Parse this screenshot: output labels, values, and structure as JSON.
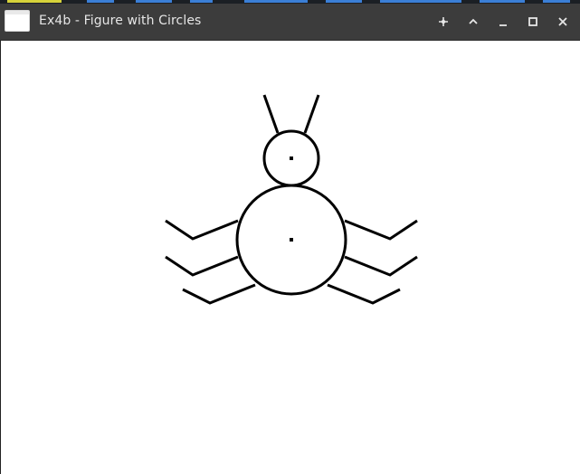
{
  "window": {
    "title": "Ex4b - Figure with Circles"
  },
  "titlebar_buttons": [
    {
      "name": "keep-above",
      "icon": "crosshair-plus-icon"
    },
    {
      "name": "shade",
      "icon": "chevron-up-icon"
    },
    {
      "name": "minimize",
      "icon": "minimize-icon"
    },
    {
      "name": "maximize",
      "icon": "maximize-icon"
    },
    {
      "name": "close",
      "icon": "close-icon"
    }
  ],
  "colors": {
    "titlebar": "#3c3c3c",
    "title_text": "#e6e6e6",
    "canvas": "#ffffff",
    "figure_stroke": "#000000"
  }
}
